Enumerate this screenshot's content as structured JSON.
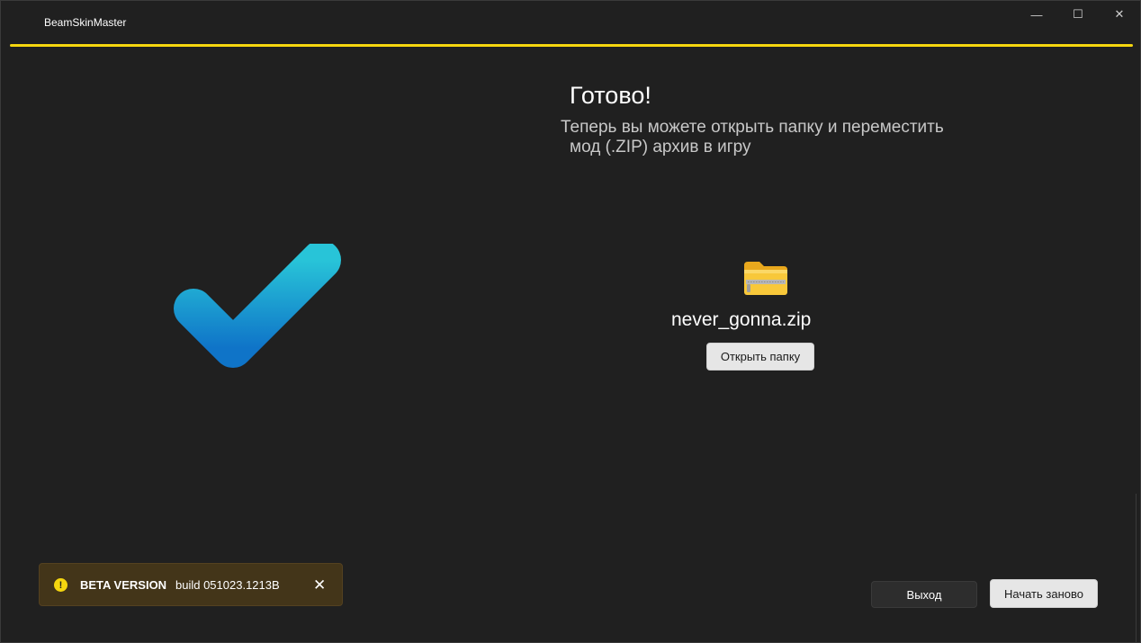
{
  "window": {
    "title": "BeamSkinMaster",
    "minimize_glyph": "—",
    "maximize_glyph": "☐",
    "close_glyph": "✕"
  },
  "colors": {
    "accent": "#f5d60f",
    "check_top": "#28c4d8",
    "check_bottom": "#0f74c8",
    "beta_bg": "#433519"
  },
  "main": {
    "heading": "Готово!",
    "subtitle_line1": "Теперь вы можете открыть папку и переместить",
    "subtitle_line2": "мод (.ZIP) архив в игру",
    "file_icon": "zip-folder-icon",
    "filename": "never_gonna.zip",
    "open_folder_label": "Открыть папку"
  },
  "beta": {
    "icon": "warning-icon",
    "icon_glyph": "!",
    "title": "BETA VERSION",
    "build": "build 051023.1213B",
    "close_glyph": "✕"
  },
  "footer": {
    "exit_label": "Выход",
    "restart_label": "Начать заново"
  }
}
